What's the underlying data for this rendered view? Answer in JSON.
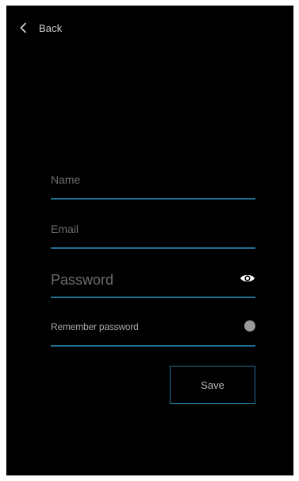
{
  "header": {
    "back_label": "Back"
  },
  "form": {
    "name": {
      "placeholder": "Name",
      "value": ""
    },
    "email": {
      "placeholder": "Email",
      "value": ""
    },
    "password": {
      "placeholder": "Password",
      "value": "",
      "visibility_icon": "eye-icon"
    },
    "remember": {
      "label": "Remember password",
      "toggle_on": false
    }
  },
  "actions": {
    "save_label": "Save"
  },
  "colors": {
    "background": "#000000",
    "accent_line": "#1f6f93",
    "placeholder": "#6d6d6d",
    "toggle_knob": "#9a9a9a"
  }
}
